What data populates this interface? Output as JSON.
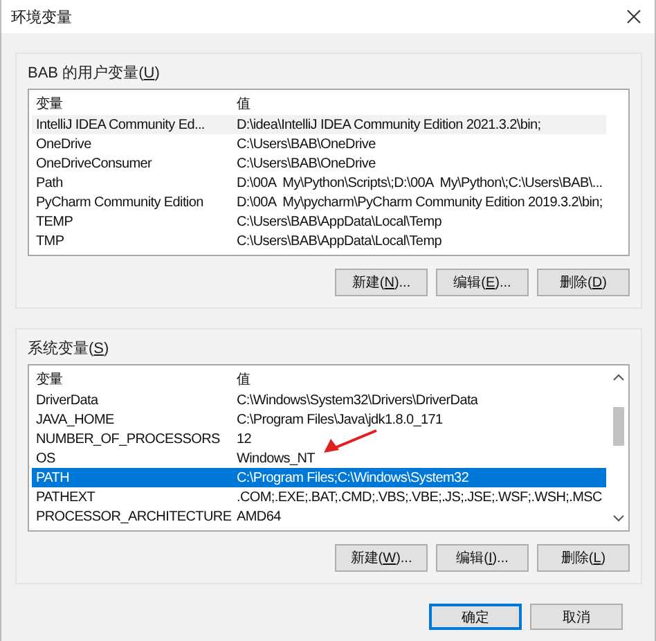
{
  "window": {
    "title": "环境变量"
  },
  "user_variables": {
    "label": {
      "before": "BAB 的用户变量(",
      "key": "U",
      "after": ")"
    },
    "focused": false,
    "columns": [
      "变量",
      "值"
    ],
    "rows": [
      {
        "name": "IntelliJ IDEA Community Ed...",
        "value": "D:\\idea\\IntelliJ IDEA Community Edition 2021.3.2\\bin;",
        "selected": true
      },
      {
        "name": "OneDrive",
        "value": "C:\\Users\\BAB\\OneDrive",
        "selected": false
      },
      {
        "name": "OneDriveConsumer",
        "value": "C:\\Users\\BAB\\OneDrive",
        "selected": false
      },
      {
        "name": "Path",
        "value": "D:\\00A  My\\Python\\Scripts\\;D:\\00A  My\\Python\\;C:\\Users\\BAB\\...",
        "selected": false
      },
      {
        "name": "PyCharm Community Edition",
        "value": "D:\\00A  My\\pycharm\\PyCharm Community Edition 2019.3.2\\bin;",
        "selected": false
      },
      {
        "name": "TEMP",
        "value": "C:\\Users\\BAB\\AppData\\Local\\Temp",
        "selected": false
      },
      {
        "name": "TMP",
        "value": "C:\\Users\\BAB\\AppData\\Local\\Temp",
        "selected": false
      }
    ],
    "buttons": [
      {
        "before": "新建(",
        "key": "N",
        "after": ")..."
      },
      {
        "before": "编辑(",
        "key": "E",
        "after": ")..."
      },
      {
        "before": "删除(",
        "key": "D",
        "after": ")"
      }
    ]
  },
  "system_variables": {
    "label": {
      "before": "系统变量(",
      "key": "S",
      "after": ")"
    },
    "focused": true,
    "columns": [
      "变量",
      "值"
    ],
    "rows": [
      {
        "name": "DriverData",
        "value": "C:\\Windows\\System32\\Drivers\\DriverData",
        "selected": false
      },
      {
        "name": "JAVA_HOME",
        "value": "C:\\Program Files\\Java\\jdk1.8.0_171",
        "selected": false
      },
      {
        "name": "NUMBER_OF_PROCESSORS",
        "value": "12",
        "selected": false
      },
      {
        "name": "OS",
        "value": "Windows_NT",
        "selected": false
      },
      {
        "name": "PATH",
        "value": "C:\\Program Files;C:\\Windows\\System32",
        "selected": true
      },
      {
        "name": "PATHEXT",
        "value": ".COM;.EXE;.BAT;.CMD;.VBS;.VBE;.JS;.JSE;.WSF;.WSH;.MSC",
        "selected": false
      },
      {
        "name": "PROCESSOR_ARCHITECTURE",
        "value": "AMD64",
        "selected": false
      }
    ],
    "buttons": [
      {
        "before": "新建(",
        "key": "W",
        "after": ")..."
      },
      {
        "before": "编辑(",
        "key": "I",
        "after": ")..."
      },
      {
        "before": "删除(",
        "key": "L",
        "after": ")"
      }
    ]
  },
  "dialog_buttons": [
    {
      "label": "确定",
      "default": true
    },
    {
      "label": "取消",
      "default": false
    }
  ]
}
